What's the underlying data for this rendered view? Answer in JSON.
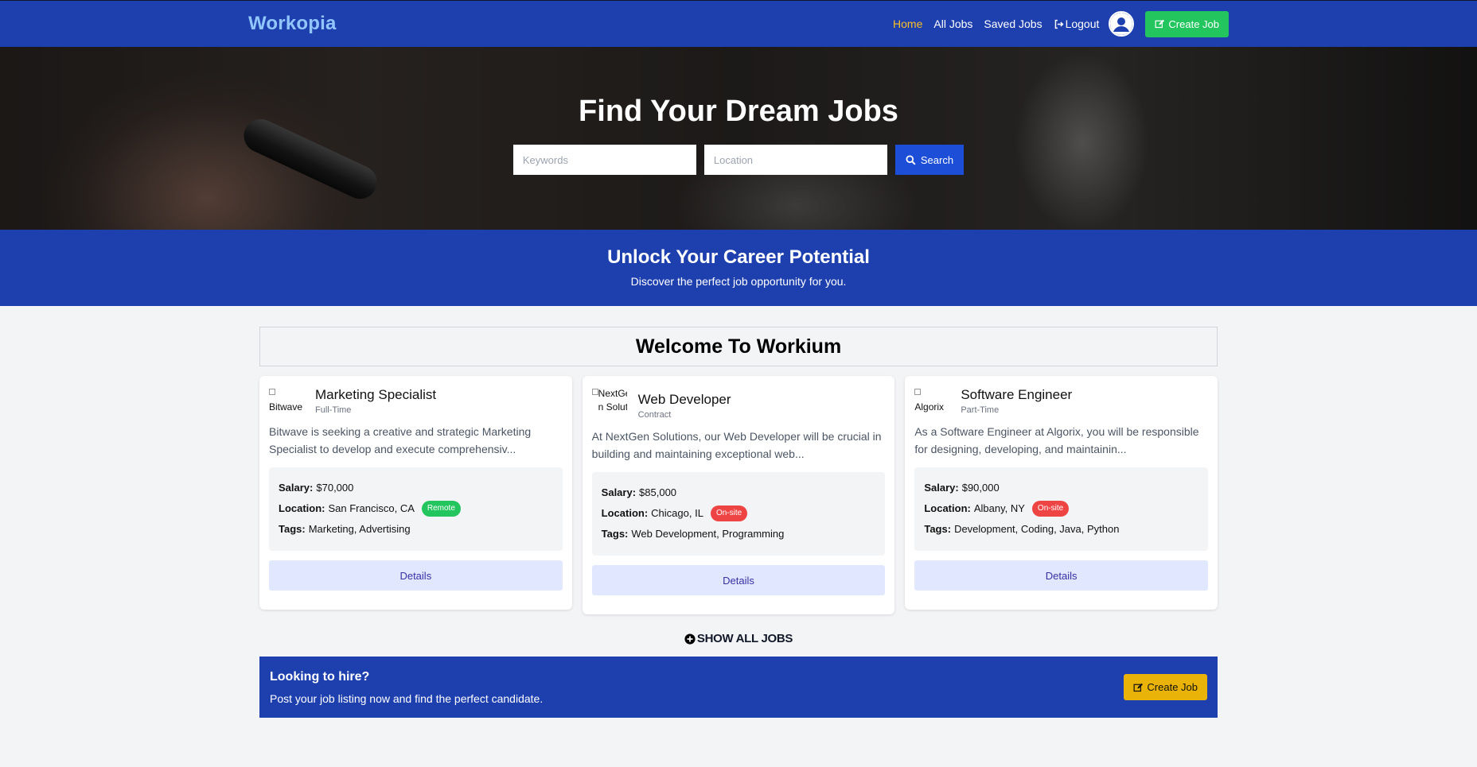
{
  "nav": {
    "brand": "Workopia",
    "links": [
      {
        "label": "Home",
        "active": true
      },
      {
        "label": "All Jobs",
        "active": false
      },
      {
        "label": "Saved Jobs",
        "active": false
      }
    ],
    "logout_label": "Logout",
    "create_job_label": "Create Job"
  },
  "hero": {
    "title": "Find Your Dream Jobs",
    "keywords_placeholder": "Keywords",
    "location_placeholder": "Location",
    "search_label": "Search"
  },
  "banner": {
    "title": "Unlock Your Career Potential",
    "subtitle": "Discover the perfect job opportunity for you."
  },
  "welcome": "Welcome To Workium",
  "labels": {
    "salary": "Salary:",
    "location": "Location:",
    "tags": "Tags:",
    "details": "Details"
  },
  "jobs": [
    {
      "company": "Bitwave",
      "title": "Marketing Specialist",
      "type": "Full-Time",
      "description": "Bitwave is seeking a creative and strategic Marketing Specialist to develop and execute comprehensiv...",
      "salary": "$70,000",
      "location": "San Francisco, CA",
      "badge": "Remote",
      "badge_color": "#22c55e",
      "tags": "Marketing, Advertising"
    },
    {
      "company": "NextGen Solutions",
      "title": "Web Developer",
      "type": "Contract",
      "description": "At NextGen Solutions, our Web Developer will be crucial in building and maintaining exceptional web...",
      "salary": "$85,000",
      "location": "Chicago, IL",
      "badge": "On-site",
      "badge_color": "#ef4444",
      "tags": "Web Development, Programming"
    },
    {
      "company": "Algorix",
      "title": "Software Engineer",
      "type": "Part-Time",
      "description": "As a Software Engineer at Algorix, you will be responsible for designing, developing, and maintainin...",
      "salary": "$90,000",
      "location": "Albany, NY",
      "badge": "On-site",
      "badge_color": "#ef4444",
      "tags": "Development, Coding, Java, Python"
    }
  ],
  "show_all_label": "SHOW ALL JOBS",
  "hire": {
    "title": "Looking to hire?",
    "subtitle": "Post your job listing now and find the perfect candidate.",
    "button_label": "Create Job"
  },
  "colors": {
    "primary": "#1e40af",
    "brand_text": "#93c5fd",
    "active_link": "#fbbf24",
    "create_green": "#22c55e",
    "create_yellow": "#eab308",
    "search_blue": "#1d4ed8",
    "details_bg": "#e0e7ff"
  },
  "icons": {
    "logout": "logout-icon",
    "avatar": "user-avatar-icon",
    "create": "edit-icon",
    "search": "search-icon",
    "show_all": "plus-circle-icon"
  }
}
